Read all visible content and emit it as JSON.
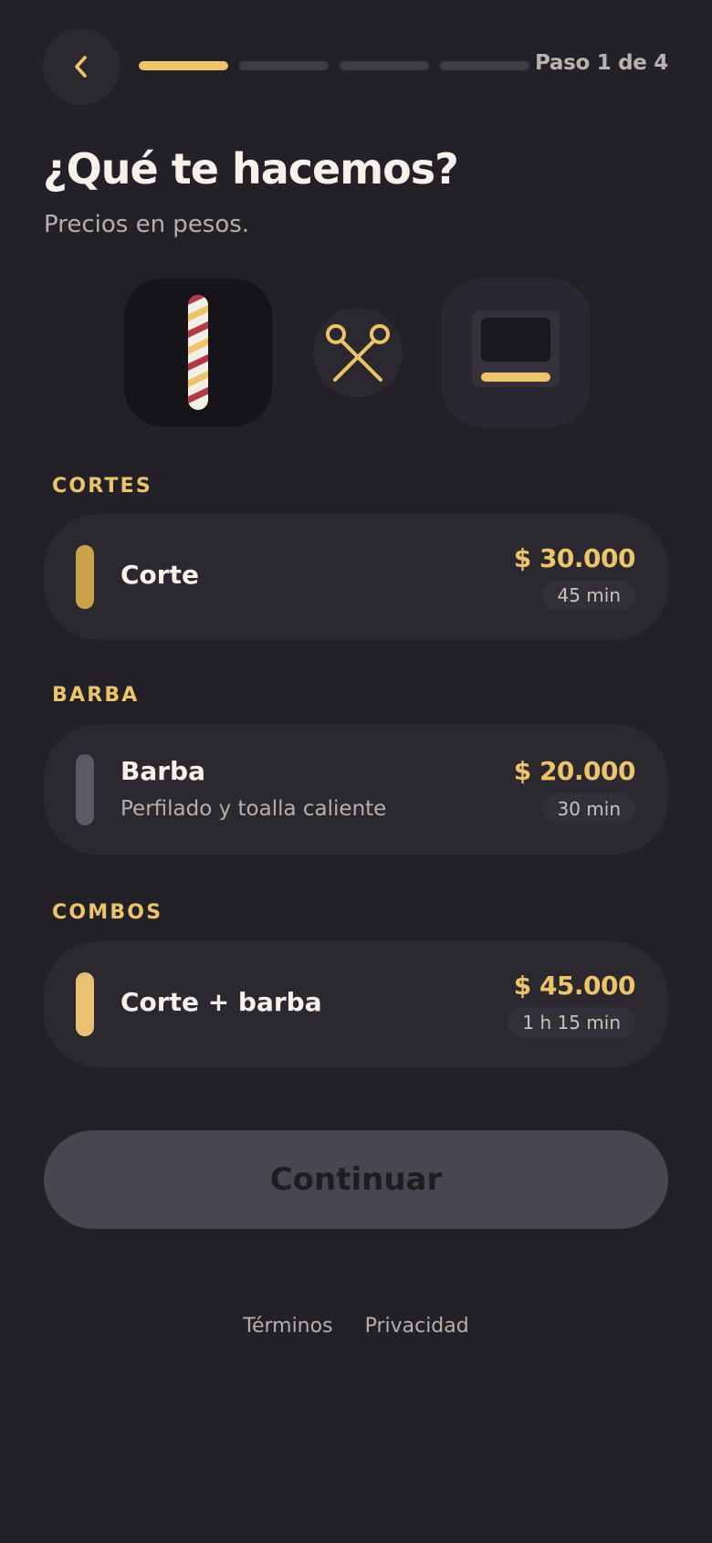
{
  "header": {
    "back_icon": "chevron-left-icon",
    "step_label": "Paso 1 de 4",
    "progress": {
      "current": 1,
      "total": 4
    }
  },
  "main": {
    "title": "¿Qué te hacemos?",
    "subtitle": "Precios en pesos."
  },
  "illustrations": [
    "barber-pole-icon",
    "scissors-icon",
    "barber-chair-icon"
  ],
  "sections": [
    {
      "label": "CORTES",
      "services": [
        {
          "name": "Corte",
          "description": "",
          "price": "$ 30.000",
          "duration": "45 min",
          "accent": "#c9a24a"
        }
      ]
    },
    {
      "label": "BARBA",
      "services": [
        {
          "name": "Barba",
          "description": "Perfilado y toalla caliente",
          "price": "$ 20.000",
          "duration": "30 min",
          "accent": "#5e5966"
        }
      ]
    },
    {
      "label": "COMBOS",
      "services": [
        {
          "name": "Corte + barba",
          "description": "",
          "price": "$ 45.000",
          "duration": "1 h 15 min",
          "accent": "#e8c272"
        }
      ]
    }
  ],
  "continue_button": {
    "label": "Continuar"
  },
  "footer": {
    "terms": "Términos",
    "privacy": "Privacidad"
  },
  "colors": {
    "background": "#232027",
    "accent": "#ecc56a",
    "card": "#2b2830",
    "button_disabled": "#4a4650"
  }
}
